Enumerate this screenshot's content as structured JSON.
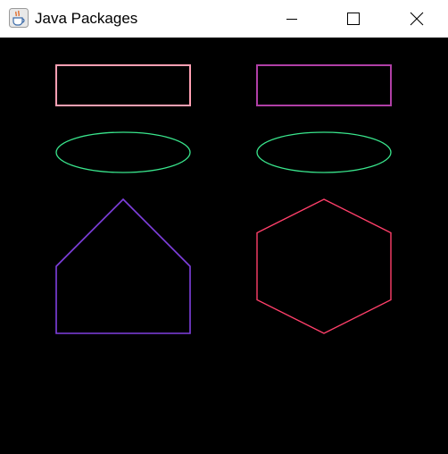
{
  "window": {
    "title": "Java Packages",
    "icon": "java-coffee-cup-icon",
    "controls": [
      "minimize-icon",
      "maximize-icon",
      "close-icon"
    ]
  },
  "canvas": {
    "background": "#000000",
    "shapes": [
      {
        "name": "rectangle-left",
        "type": "rectangle",
        "stroke": "#ff9fb3"
      },
      {
        "name": "rectangle-right",
        "type": "rectangle",
        "stroke": "#b03fa6"
      },
      {
        "name": "ellipse-left",
        "type": "ellipse",
        "stroke": "#39e58c"
      },
      {
        "name": "ellipse-right",
        "type": "ellipse",
        "stroke": "#39e58c"
      },
      {
        "name": "pentagon-house",
        "type": "pentagon",
        "stroke": "#8040e0"
      },
      {
        "name": "hexagon",
        "type": "hexagon",
        "stroke": "#ff3f6a"
      }
    ]
  }
}
